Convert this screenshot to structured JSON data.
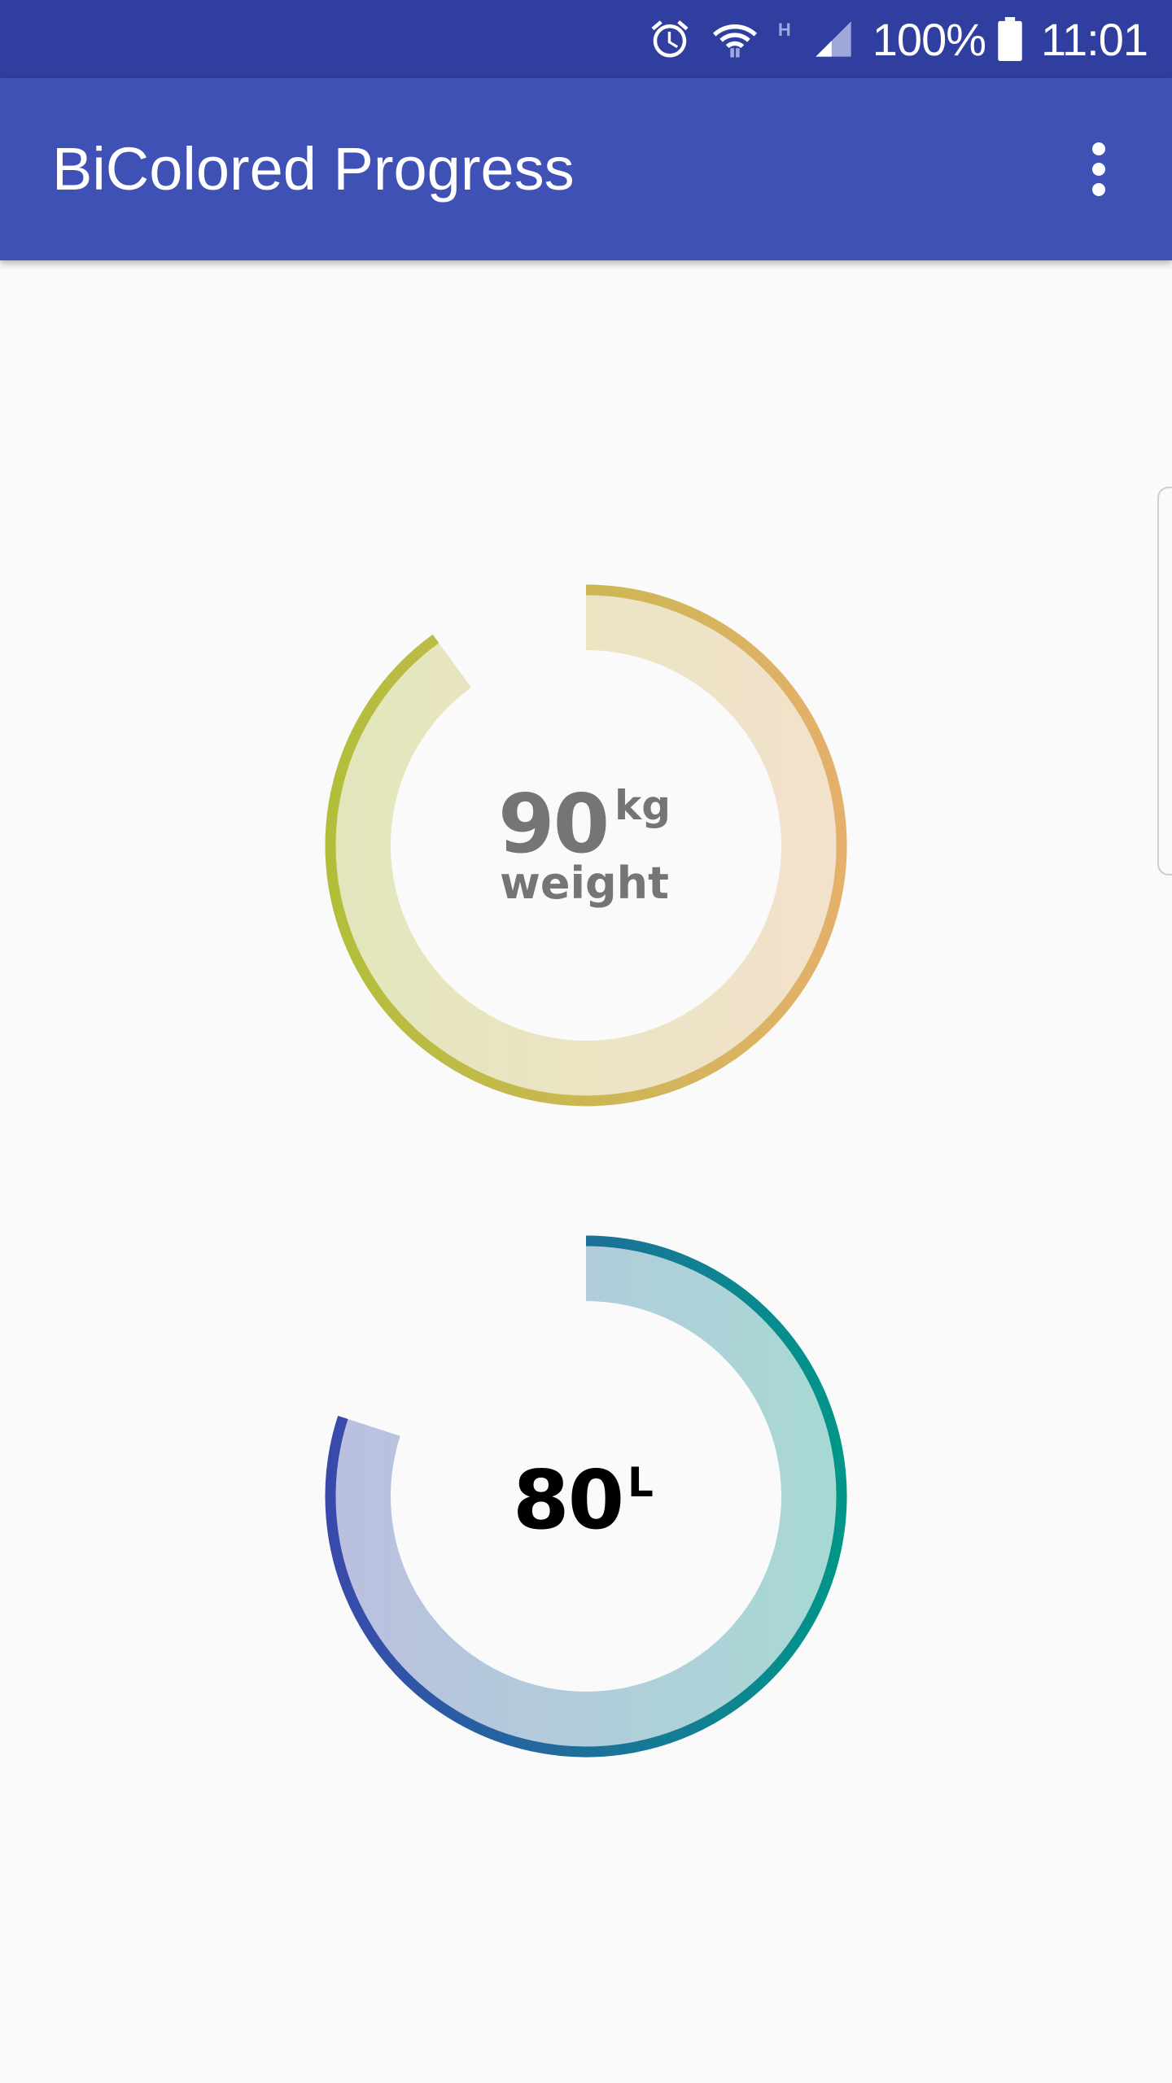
{
  "status_bar": {
    "icons": [
      "alarm-icon",
      "wifi-icon",
      "network-type-h-icon",
      "signal-icon",
      "battery-icon"
    ],
    "network_type": "H",
    "battery": "100%",
    "time": "11:01"
  },
  "app_bar": {
    "title": "BiColored Progress",
    "menu_icon": "more-vert-icon"
  },
  "gauges": [
    {
      "value": "90",
      "unit": "kg",
      "label": "weight",
      "progress": 0.9,
      "text_color": "#757575",
      "colors": {
        "start": "#b2be3a",
        "end": "#e4b06b"
      }
    },
    {
      "value": "80",
      "unit": "L",
      "label": "",
      "progress": 0.8,
      "text_color": "#000000",
      "colors": {
        "start": "#3949ab",
        "end": "#009688"
      }
    }
  ],
  "colors": {
    "status_bar": "#303f9f",
    "app_bar": "#3f51b5",
    "background": "#fafafa"
  }
}
